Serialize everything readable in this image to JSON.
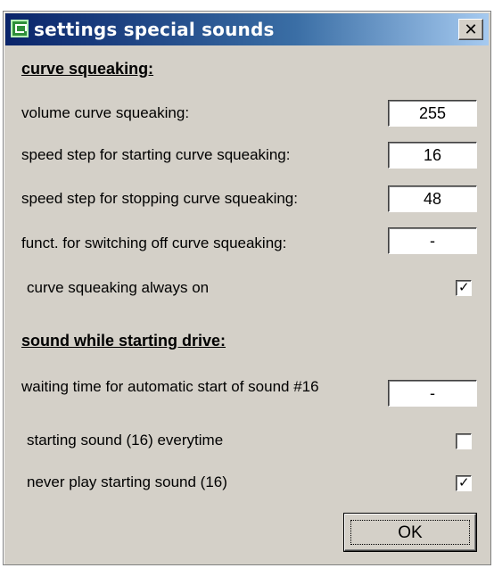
{
  "window": {
    "title": "settings special sounds",
    "close_glyph": "✕"
  },
  "curve": {
    "heading": "curve squeaking:",
    "volume_label": "volume curve squeaking:",
    "volume_value": "255",
    "start_label": "speed step for starting curve squeaking:",
    "start_value": "16",
    "stop_label": "speed step for stopping curve squeaking:",
    "stop_value": "48",
    "switch_off_label": "funct. for switching off curve squeaking:",
    "switch_off_value": "-",
    "always_on_label": "curve squeaking always on",
    "always_on_checked": true
  },
  "drive": {
    "heading": "sound while starting drive:",
    "waiting_label": "waiting time for automatic start of sound #16",
    "waiting_value": "-",
    "everytime_label": "starting sound (16) everytime",
    "everytime_checked": false,
    "never_label": "never play starting sound (16)",
    "never_checked": true
  },
  "buttons": {
    "ok_label": "OK"
  },
  "icons": {
    "title_icon": "app-window-icon",
    "close_icon": "close-icon",
    "check_icon": "checkmark-icon"
  }
}
